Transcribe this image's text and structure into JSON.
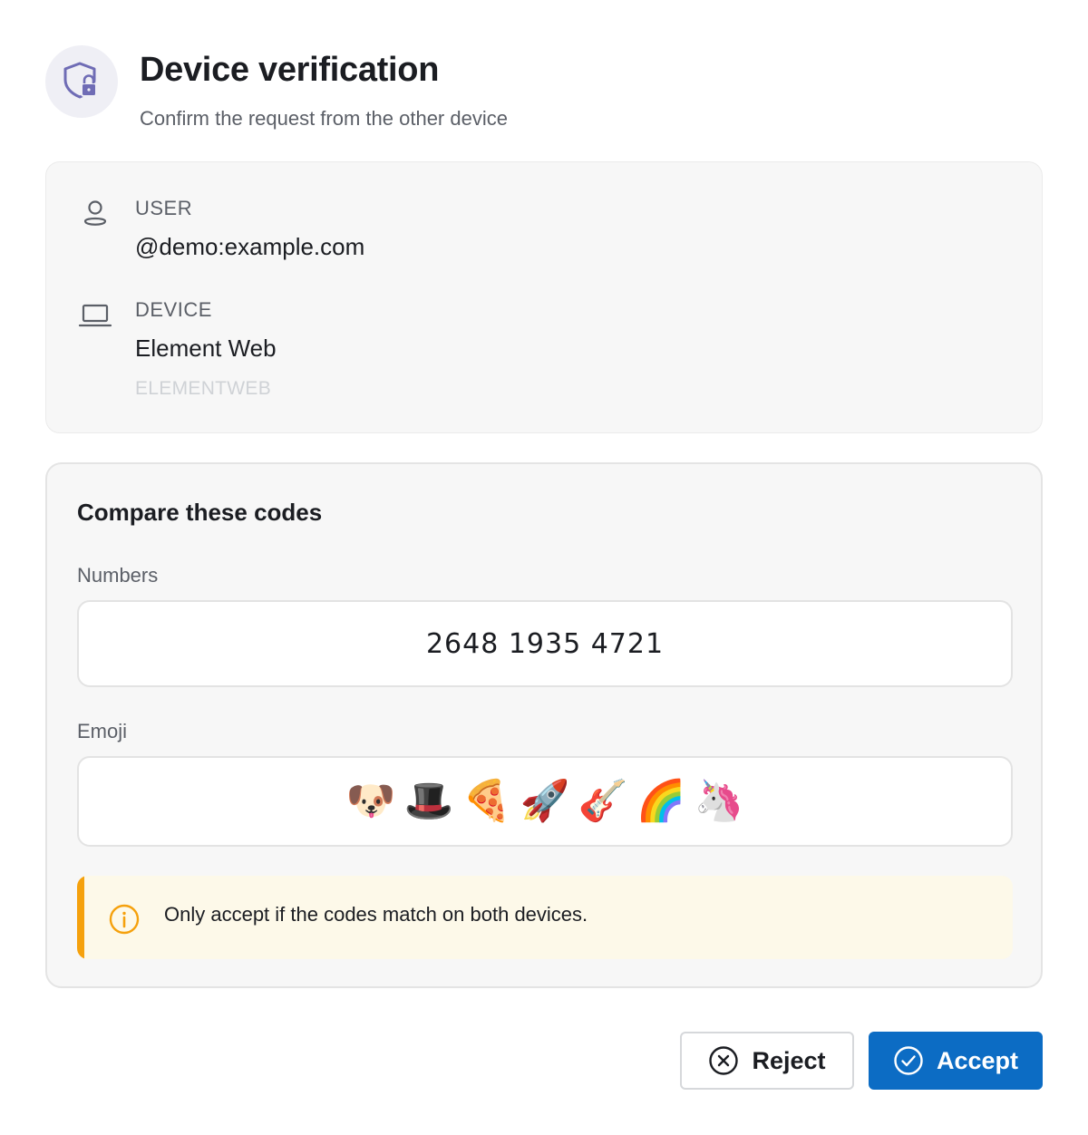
{
  "dialog": {
    "title": "Device verification",
    "subtitle": "Confirm the request from the other device",
    "header_icon": "shield-lock-icon"
  },
  "info": {
    "user": {
      "label": "USER",
      "value": "@demo:example.com",
      "icon": "user-icon"
    },
    "device": {
      "label": "DEVICE",
      "value": "Element Web",
      "id": "ELEMENTWEB",
      "icon": "laptop-icon"
    }
  },
  "compare": {
    "title": "Compare these codes",
    "numbers_label": "Numbers",
    "numbers": "2648 1935 4721",
    "emoji_label": "Emoji",
    "emojis": [
      {
        "glyph": "🐶",
        "name": "dog"
      },
      {
        "glyph": "🎩",
        "name": "top-hat"
      },
      {
        "glyph": "🍕",
        "name": "pizza"
      },
      {
        "glyph": "🚀",
        "name": "rocket"
      },
      {
        "glyph": "🎸",
        "name": "guitar"
      },
      {
        "glyph": "🌈",
        "name": "rainbow"
      },
      {
        "glyph": "🦄",
        "name": "unicorn"
      }
    ],
    "warning": "Only accept if the codes match on both devices."
  },
  "actions": {
    "reject_label": "Reject",
    "accept_label": "Accept"
  },
  "colors": {
    "accent": "#0c6cc4",
    "warning": "#f5a10d",
    "warning_bg": "#fdf9e9",
    "badge_bg": "#efeff5",
    "shield": "#6f6cb5"
  }
}
